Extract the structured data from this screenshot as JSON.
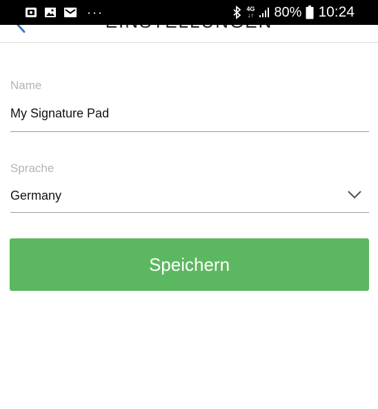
{
  "status_bar": {
    "network": [
      "4G",
      "↓↑"
    ],
    "battery_percent": "80%",
    "time": "10:24",
    "more": "···"
  },
  "header": {
    "title": "EINSTELLUNGEN"
  },
  "form": {
    "name": {
      "label": "Name",
      "value": "My Signature Pad"
    },
    "language": {
      "label": "Sprache",
      "value": "Germany"
    },
    "save_label": "Speichern"
  },
  "colors": {
    "accent": "#5cb860",
    "back_icon": "#3b7bbf",
    "label": "#b3b3b3"
  }
}
